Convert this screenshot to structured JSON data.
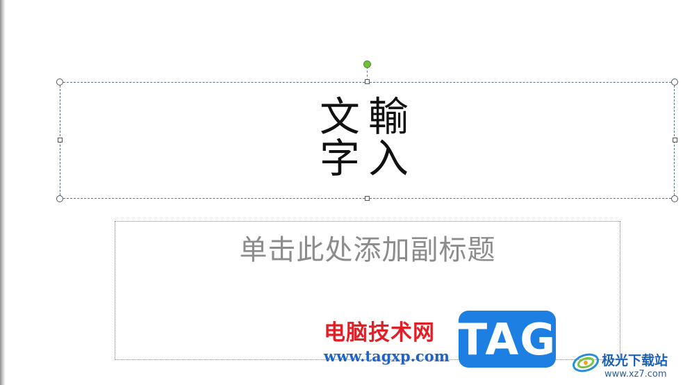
{
  "slide": {
    "title": {
      "chars": [
        "文",
        "輸",
        "字",
        "入"
      ]
    },
    "subtitle_placeholder": "单击此处添加副标题"
  },
  "watermark": {
    "site_name": "电脑技术网",
    "site_url": "www.tagxp.com",
    "tag_logo": "TAG",
    "xz_name": "极光下载站",
    "xz_url": "www.xz7.com"
  },
  "colors": {
    "selection_border": "#5d7889",
    "rotation_handle": "#6ec13c",
    "subtitle_text": "#8c8c8c",
    "site_name": "#e01f26",
    "site_url": "#1f63c9",
    "tag_logo_bg": "#1e7fe3"
  }
}
